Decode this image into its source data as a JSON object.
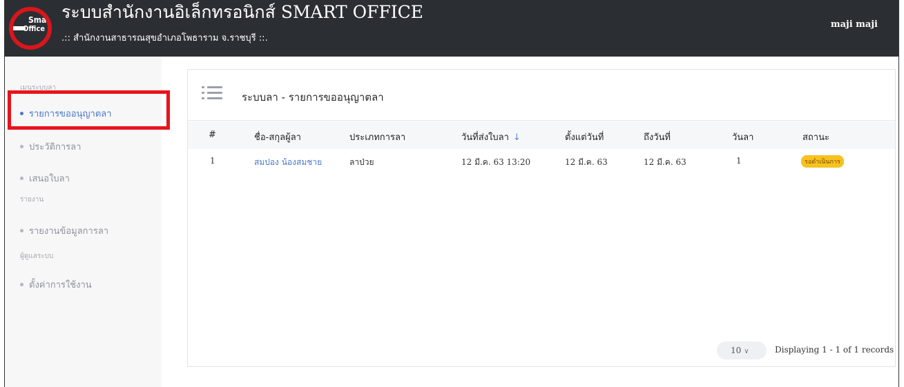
{
  "header": {
    "logo": {
      "line1": "Smart",
      "line2": "Office"
    },
    "title": "ระบบสำนักงานอิเล็กทรอนิกส์ SMART OFFICE",
    "subtitle": ".:: สำนักงานสาธารณสุขอำเภอโพธาราม จ.ราชบุรี ::.",
    "user": "maji maji"
  },
  "sidebar": {
    "section_leave": "เมนูระบบลา",
    "items_leave": [
      {
        "label": "รายการขออนุญาตลา",
        "active": true
      },
      {
        "label": "ประวัติการลา"
      },
      {
        "label": "เสนอใบลา"
      }
    ],
    "section_report": "รายงาน",
    "items_report": [
      {
        "label": "รายงานข้อมูลการลา"
      }
    ],
    "section_admin": "ผู้ดูแลระบบ",
    "items_admin": [
      {
        "label": "ตั้งค่าการใช้งาน"
      }
    ]
  },
  "main": {
    "title": "ระบบลา - รายการขออนุญาตลา",
    "columns": [
      "#",
      "ชื่อ-สกุลผู้ลา",
      "ประเภทการลา",
      "วันที่ส่งใบลา",
      "ตั้งแต่วันที่",
      "ถึงวันที่",
      "วันลา",
      "สถานะ"
    ],
    "sort_icon": "arrow-down-icon",
    "rows": [
      {
        "no": "1",
        "name": "สมปอง น้องสมชาย",
        "type": "ลาป่วย",
        "submitted": "12 มี.ค. 63 13:20",
        "from": "12 มี.ค. 63",
        "to": "12 มี.ค. 63",
        "days": "1",
        "status": "รอดำเนินการ"
      }
    ],
    "page_size": "10",
    "records_text": "Displaying 1 - 1 of 1 records"
  },
  "colors": {
    "header_bg": "#2b2f33",
    "logo_ring": "#d9161b",
    "highlight": "#e8141b",
    "accent": "#4a77c8",
    "status_badge": "#f7c21f"
  }
}
